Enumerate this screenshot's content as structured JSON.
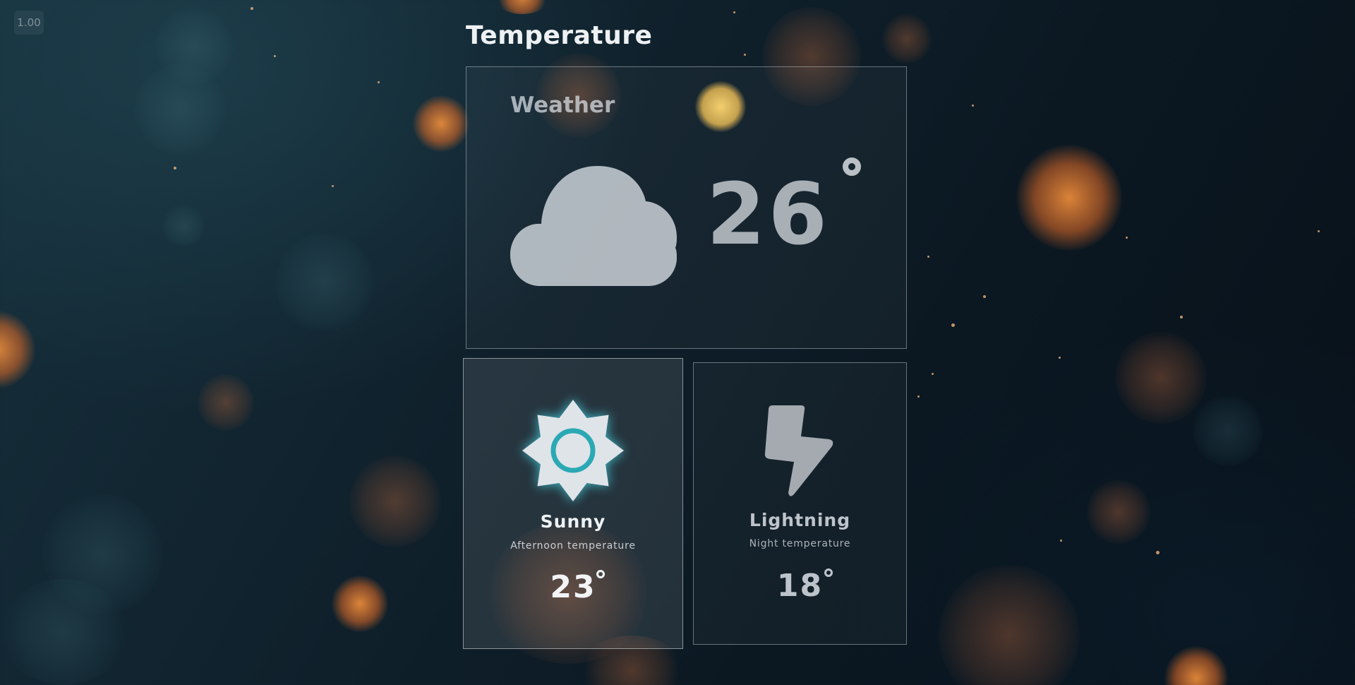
{
  "zoom": {
    "value": "1.00"
  },
  "page": {
    "title": "Temperature"
  },
  "weather_card": {
    "label": "Weather",
    "temperature": "26",
    "icon": "cloud-icon"
  },
  "forecast": [
    {
      "title": "Sunny",
      "description": "Afternoon temperature",
      "temperature": "23",
      "icon": "sun-icon",
      "highlighted": true
    },
    {
      "title": "Lightning",
      "description": "Night temperature",
      "temperature": "18",
      "icon": "lightning-icon",
      "highlighted": false
    }
  ],
  "colors": {
    "accent": "#2aa9b4",
    "background": "#10222d",
    "bokeh": "#e8823a"
  }
}
